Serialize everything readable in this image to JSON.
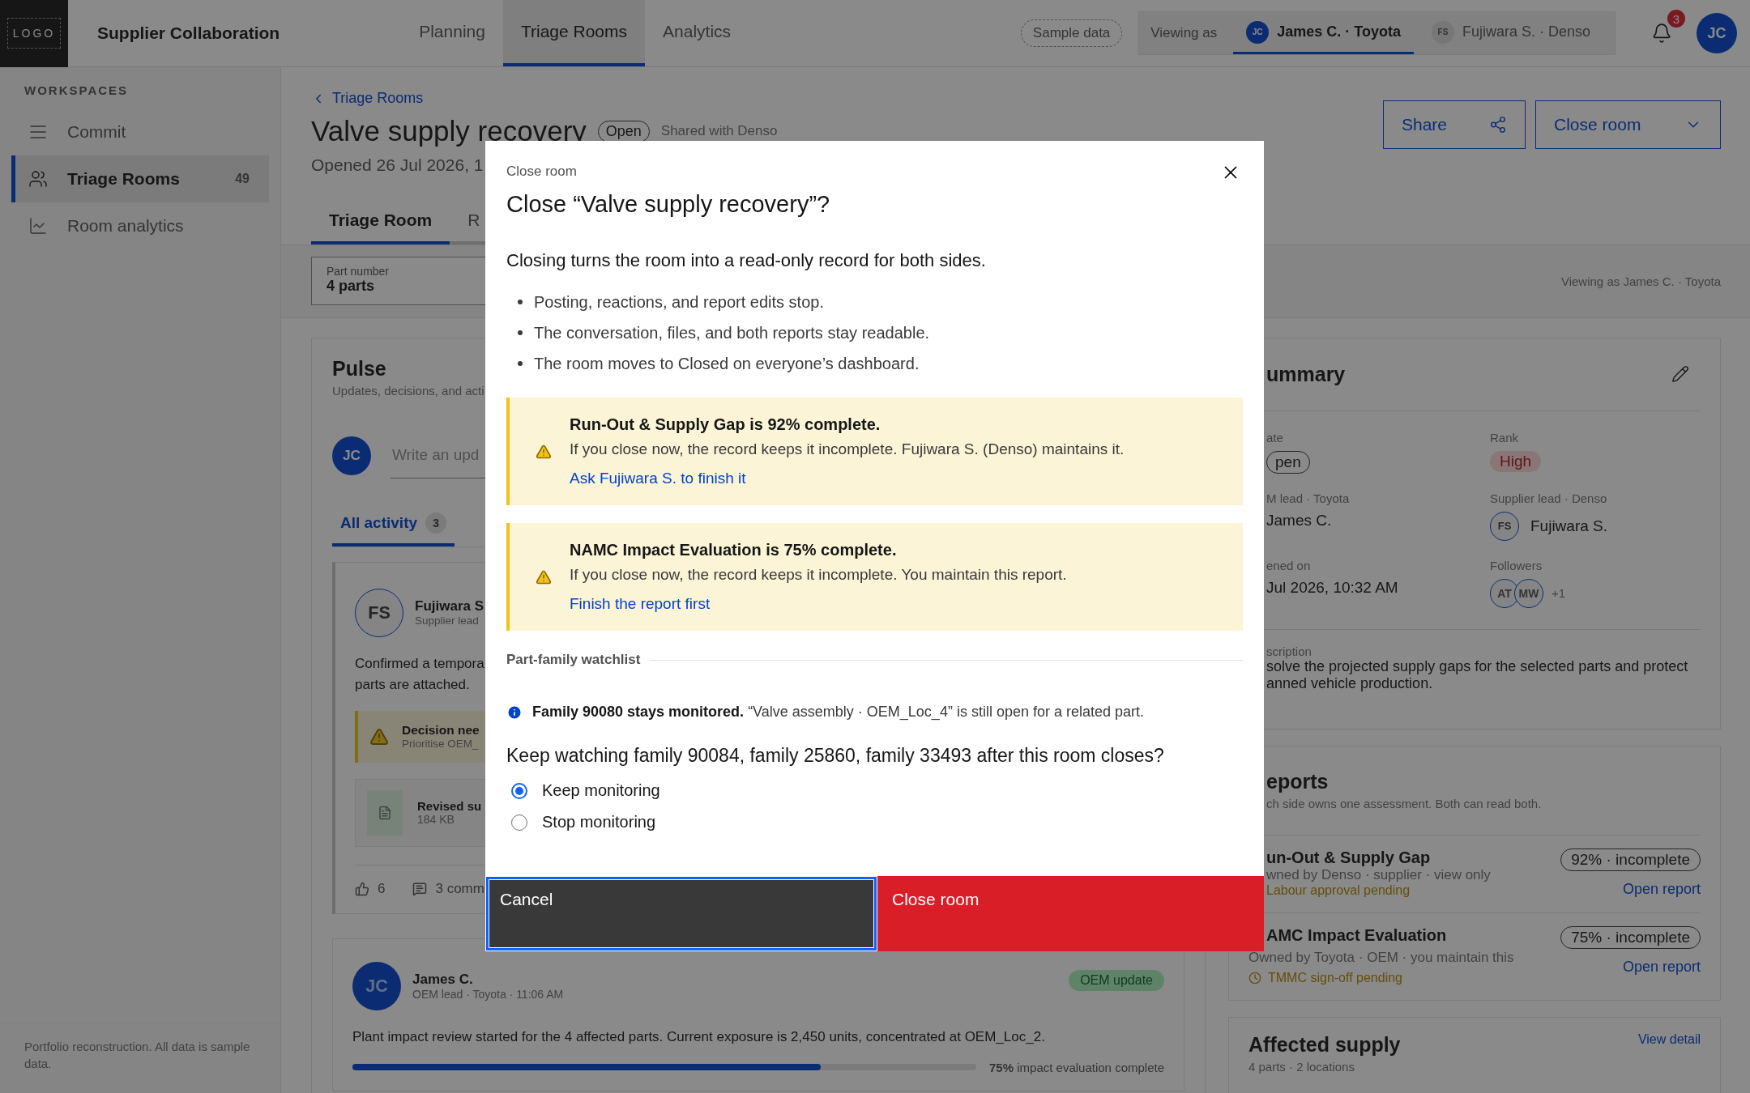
{
  "app": {
    "logo": "LOGO",
    "title": "Supplier Collaboration"
  },
  "nav": [
    {
      "label": "Planning",
      "selected": false
    },
    {
      "label": "Triage Rooms",
      "selected": true
    },
    {
      "label": "Analytics",
      "selected": false
    }
  ],
  "sample_badge": "Sample data",
  "viewing_as": {
    "label": "Viewing as",
    "options": [
      {
        "initials": "JC",
        "name": "James C. · Toyota",
        "selected": true
      },
      {
        "initials": "FS",
        "name": "Fujiwara S. · Denso",
        "selected": false
      }
    ]
  },
  "notifications": {
    "count": "3"
  },
  "user": {
    "initials": "JC"
  },
  "sidebar": {
    "heading": "WORKSPACES",
    "items": [
      {
        "label": "Commit",
        "selected": false
      },
      {
        "label": "Triage Rooms",
        "count": "49",
        "selected": true
      },
      {
        "label": "Room analytics",
        "selected": false
      }
    ],
    "footer": "Portfolio reconstruction. All data is sample data."
  },
  "room": {
    "breadcrumb": "Triage Rooms",
    "title": "Valve supply recovery",
    "status": "Open",
    "shared": "Shared with Denso",
    "opened": "Opened 26 Jul 2026, 1",
    "actions": [
      {
        "label": "Share",
        "kind": "share"
      },
      {
        "label": "Close room",
        "kind": "close"
      }
    ],
    "tabs": [
      {
        "label": "Triage Room",
        "selected": true
      },
      {
        "label": "R",
        "selected": false
      }
    ]
  },
  "filters": {
    "part_number": {
      "label": "Part number",
      "value": "4 parts"
    },
    "viewing_note": "Viewing as James C. · Toyota"
  },
  "pulse": {
    "title": "Pulse",
    "subtitle": "Updates, decisions, and acti",
    "composer": {
      "initials": "JC",
      "placeholder": "Write an upd"
    },
    "tabs": [
      {
        "label": "All activity",
        "count": "3",
        "selected": true
      }
    ],
    "posts": [
      {
        "initials": "FS",
        "author": "Fujiwara S",
        "role": "Supplier lead",
        "body": [
          "Confirmed a tempora",
          "parts are attached."
        ],
        "decision": {
          "title": "Decision nee",
          "text": "Prioritise OEM_"
        },
        "file": {
          "name": "Revised su",
          "size": "184 KB"
        },
        "likes": "6",
        "comments": "3 comm"
      },
      {
        "initials": "JC",
        "author": "James C.",
        "role": "OEM lead · Toyota · 11:06 AM",
        "tag": "OEM update",
        "body": [
          "Plant impact review started for the 4 affected parts. Current exposure is 2,450 units, concentrated at OEM_Loc_2."
        ],
        "progress": {
          "level": 0.75,
          "label": "**75%** impact evaluation complete"
        }
      }
    ]
  },
  "summary": {
    "title": "ummary",
    "fields": [
      {
        "label": "ate",
        "value": "pen",
        "kind": "pill"
      },
      {
        "label": "Rank",
        "value": "High",
        "kind": "rank"
      },
      {
        "label": "M lead · Toyota",
        "value": "James C.",
        "kind": "person"
      },
      {
        "label": "Supplier lead · Denso",
        "initials": "FS",
        "value": "Fujiwara S.",
        "kind": "person"
      },
      {
        "label": "ened on",
        "value": "Jul 2026, 10:32 AM",
        "kind": "text"
      },
      {
        "label": "Followers",
        "kind": "followers",
        "initials": [
          "AT",
          "MW"
        ],
        "more": "+1"
      }
    ],
    "description": {
      "label": "scription",
      "lines": [
        "solve the projected supply gaps for the selected parts and protect",
        "anned vehicle production."
      ]
    }
  },
  "reports": {
    "title": "eports",
    "subtitle": "ch side owns one assessment. Both can read both.",
    "items": [
      {
        "name": "un-Out & Supply Gap",
        "owner": "wned by Denso · supplier · view only",
        "pending": "Labour approval pending",
        "status": "92% · incomplete",
        "link": "Open report"
      },
      {
        "name": "AMC Impact Evaluation",
        "owner": "Owned by Toyota · OEM · you maintain this",
        "pending": "TMMC sign-off pending",
        "status": "75% · incomplete",
        "link": "Open report"
      }
    ]
  },
  "affected": {
    "title": "Affected supply",
    "subtitle": "4 parts · 2 locations",
    "link": "View detail"
  },
  "dialog": {
    "eyebrow": "Close room",
    "title": "Close “Valve supply recovery”?",
    "intro": "Closing turns the room into a read-only record for both sides.",
    "bullets": [
      "Posting, reactions, and report edits stop.",
      "The conversation, files, and both reports stay readable.",
      "The room moves to Closed on everyone’s dashboard."
    ],
    "warnings": [
      {
        "title": "Run-Out & Supply Gap is 92% complete.",
        "text": "If you close now, the record keeps it incomplete. Fujiwara S. (Denso) maintains it.",
        "link": "Ask Fujiwara S. to finish it"
      },
      {
        "title": "NAMC Impact Evaluation is 75% complete.",
        "text": "If you close now, the record keeps it incomplete. You maintain this report.",
        "link": "Finish the report first"
      }
    ],
    "watchlist": {
      "heading": "Part-family watchlist",
      "note": "**Family 90080 stays monitored.** “Valve assembly · OEM_Loc_4” is still open for a related part.",
      "question": "Keep watching family 90084, family 25860, family 33493 after this room closes?",
      "options": [
        {
          "label": "Keep monitoring",
          "selected": true
        },
        {
          "label": "Stop monitoring",
          "selected": false
        }
      ]
    },
    "buttons": [
      {
        "label": "Cancel",
        "kind": "secondary",
        "focused": true
      },
      {
        "label": "Close room",
        "kind": "danger",
        "focused": false
      }
    ]
  }
}
